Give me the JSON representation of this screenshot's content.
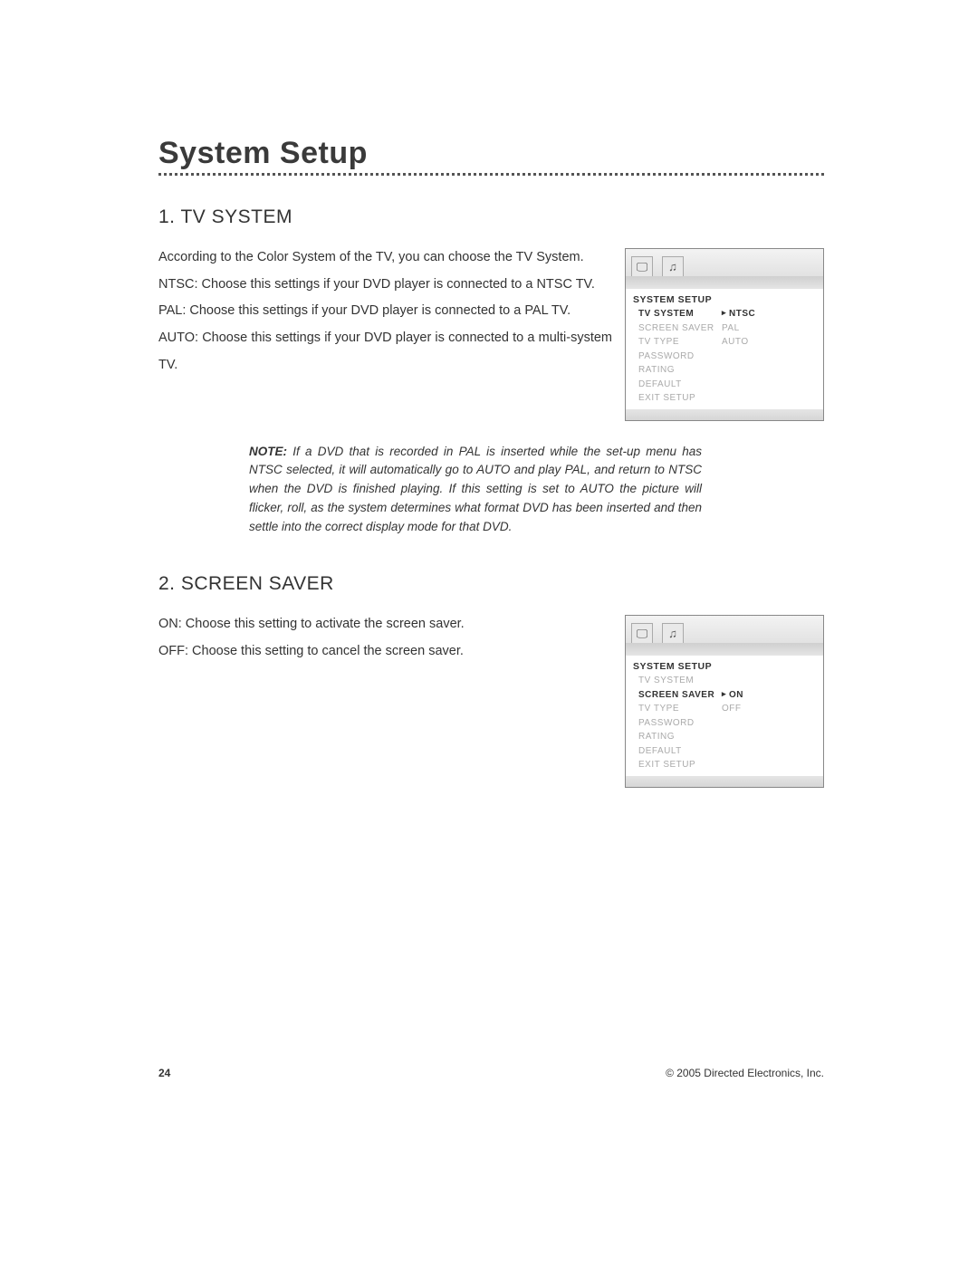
{
  "page_title": "System Setup",
  "section1": {
    "heading": "1.  TV SYSTEM",
    "paragraph": "According to the Color System of the TV, you can choose the TV System.\nNTSC: Choose this settings if your DVD player is connected to a NTSC TV.\nPAL: Choose this settings if your DVD player is connected to a PAL TV.\nAUTO: Choose this settings if your DVD player is connected to a multi-system TV.",
    "note_label": "NOTE:",
    "note_body": "If a DVD that is recorded in PAL is inserted while the set-up menu has NTSC selected, it will automatically go to AUTO and play PAL, and return to NTSC when the DVD is finished playing. If this setting is set to AUTO the picture will flicker, roll, as the system determines what format DVD has been inserted and then settle into the correct display mode for that DVD."
  },
  "section2": {
    "heading": "2.  SCREEN SAVER",
    "paragraph": "ON: Choose this setting to activate the screen saver.\nOFF: Choose this setting to cancel the screen saver."
  },
  "osd1": {
    "title": "SYSTEM  SETUP",
    "selected_index": 0,
    "left": [
      "TV  SYSTEM",
      "SCREEN  SAVER",
      "TV  TYPE",
      "PASSWORD",
      "RATING",
      "DEFAULT",
      "EXIT  SETUP"
    ],
    "right": [
      "NTSC",
      "PAL",
      "AUTO",
      "",
      "",
      "",
      ""
    ]
  },
  "osd2": {
    "title": "SYSTEM  SETUP",
    "selected_index": 1,
    "left": [
      "TV  SYSTEM",
      "SCREEN  SAVER",
      "TV  TYPE",
      "PASSWORD",
      "RATING",
      "DEFAULT",
      "EXIT  SETUP"
    ],
    "right": [
      "",
      "ON",
      "OFF",
      "",
      "",
      "",
      ""
    ]
  },
  "footer": {
    "page_number": "24",
    "copyright": "© 2005 Directed Electronics, Inc."
  },
  "icons": {
    "monitor": "🖵",
    "speaker": "♫"
  }
}
